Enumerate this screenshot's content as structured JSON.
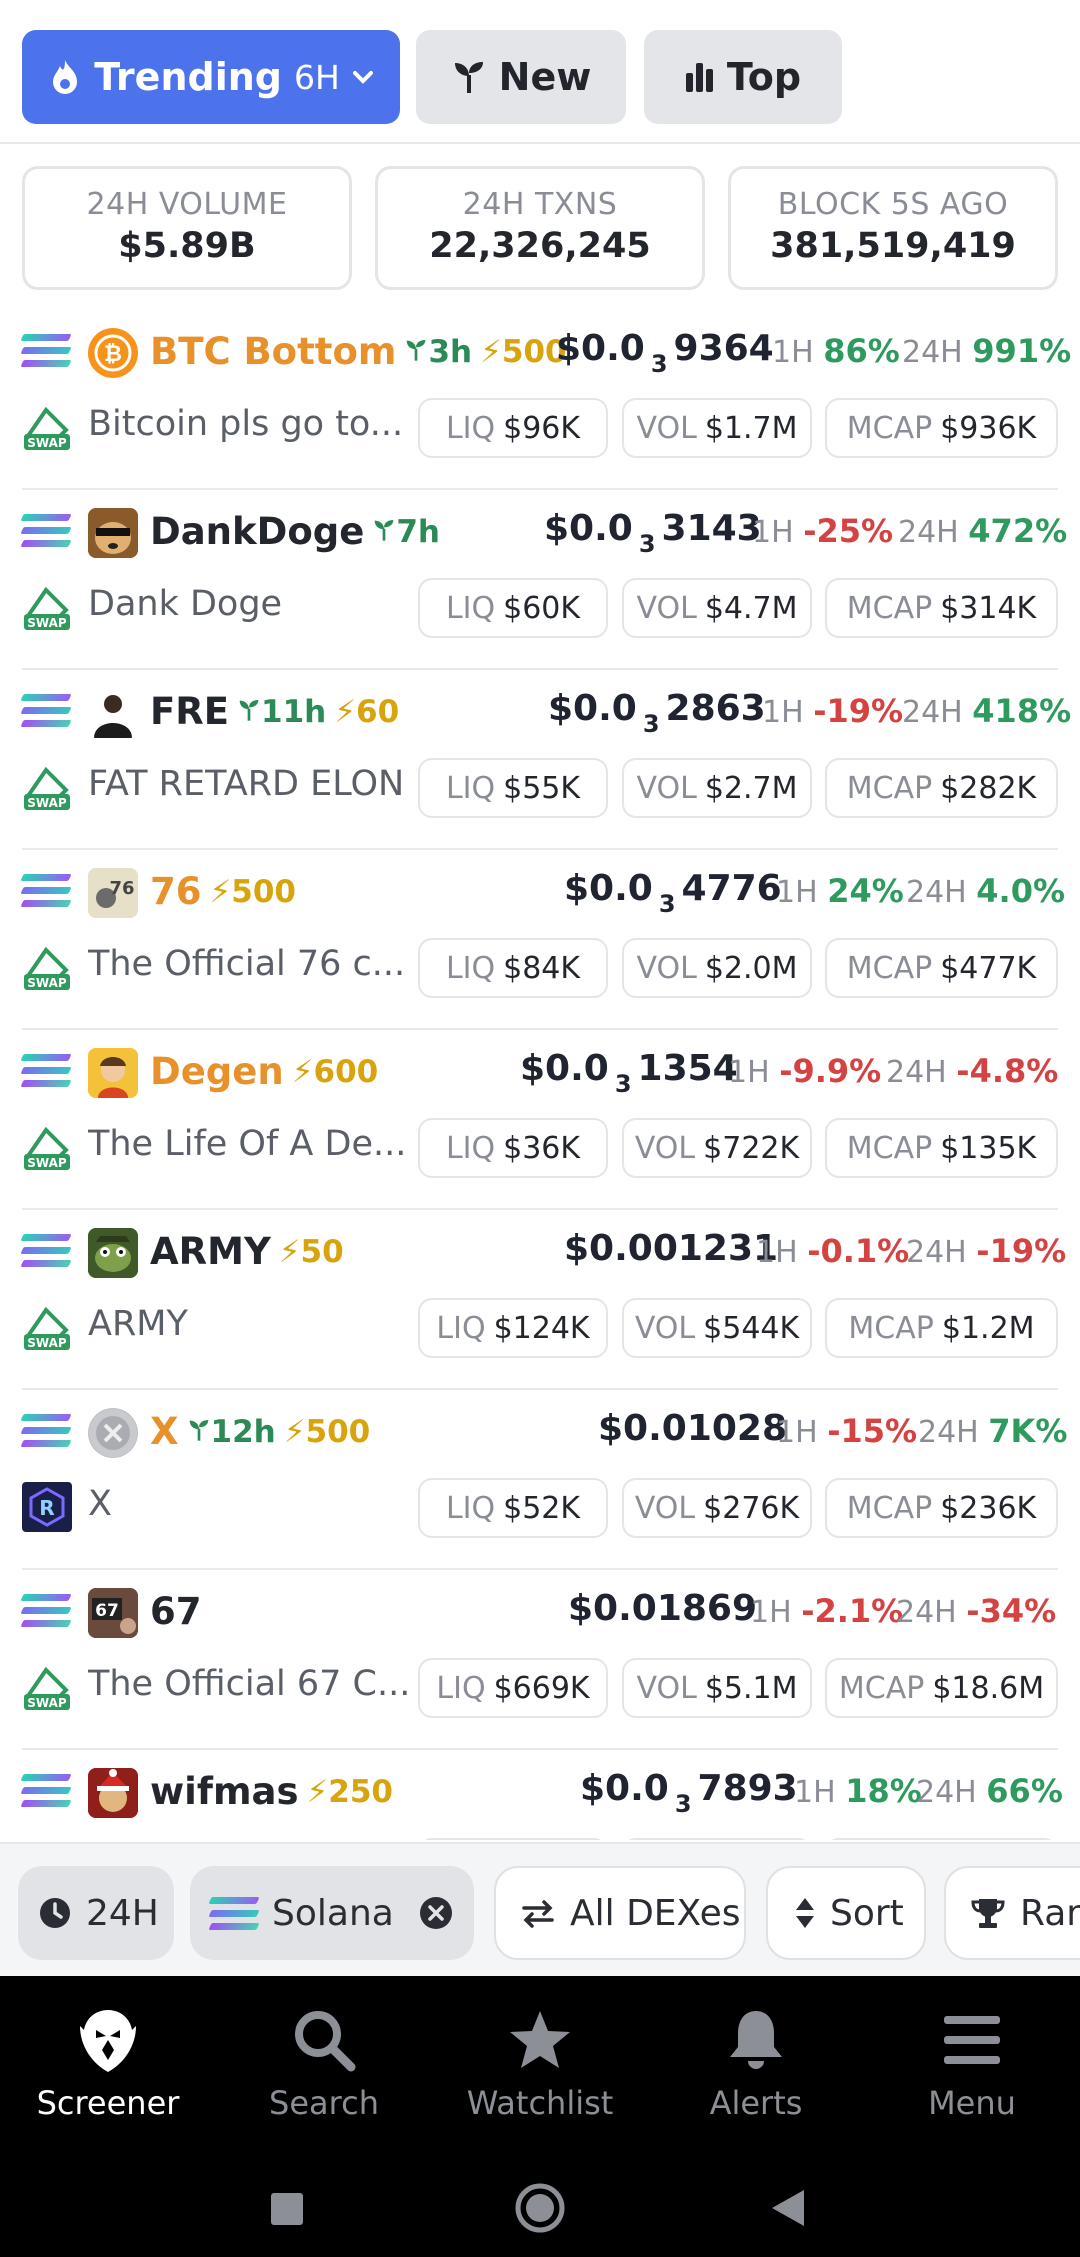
{
  "tabs": {
    "trending": {
      "label": "Trending",
      "period": "6H"
    },
    "new": {
      "label": "New"
    },
    "top": {
      "label": "Top"
    }
  },
  "stats": [
    {
      "label": "24H VOLUME",
      "value": "$5.89B"
    },
    {
      "label": "24H TXNS",
      "value": "22,326,245"
    },
    {
      "label": "BLOCK 5S AGO",
      "value": "381,519,419"
    }
  ],
  "pairs": [
    {
      "symbol": "BTC Bottom",
      "age": "3h",
      "boost": "500",
      "price_prefix": "$0.0",
      "price_zeros": "3",
      "price_rest": "9364",
      "h1": "86%",
      "h24": "991%",
      "name": "Bitcoin pls go to...",
      "liq": "$96K",
      "vol": "$1.7M",
      "mcap": "$936K"
    },
    {
      "symbol": "DankDoge",
      "age": "7h",
      "boost": "",
      "price_prefix": "$0.0",
      "price_zeros": "3",
      "price_rest": "3143",
      "h1": "-25%",
      "h24": "472%",
      "name": "Dank Doge",
      "liq": "$60K",
      "vol": "$4.7M",
      "mcap": "$314K"
    },
    {
      "symbol": "FRE",
      "age": "11h",
      "boost": "60",
      "price_prefix": "$0.0",
      "price_zeros": "3",
      "price_rest": "2863",
      "h1": "-19%",
      "h24": "418%",
      "name": "FAT RETARD ELON",
      "liq": "$55K",
      "vol": "$2.7M",
      "mcap": "$282K"
    },
    {
      "symbol": "76",
      "age": "",
      "boost": "500",
      "price_prefix": "$0.0",
      "price_zeros": "3",
      "price_rest": "4776",
      "h1": "24%",
      "h24": "4.0%",
      "name": "The Official 76 c...",
      "liq": "$84K",
      "vol": "$2.0M",
      "mcap": "$477K"
    },
    {
      "symbol": "Degen",
      "age": "",
      "boost": "600",
      "price_prefix": "$0.0",
      "price_zeros": "3",
      "price_rest": "1354",
      "h1": "-9.9%",
      "h24": "-4.8%",
      "name": "The Life Of A De...",
      "liq": "$36K",
      "vol": "$722K",
      "mcap": "$135K"
    },
    {
      "symbol": "ARMY",
      "age": "",
      "boost": "50",
      "price_prefix": "$0.001231",
      "price_zeros": "",
      "price_rest": "",
      "h1": "-0.1%",
      "h24": "-19%",
      "name": "ARMY",
      "liq": "$124K",
      "vol": "$544K",
      "mcap": "$1.2M"
    },
    {
      "symbol": "X",
      "age": "12h",
      "boost": "500",
      "price_prefix": "$0.01028",
      "price_zeros": "",
      "price_rest": "",
      "h1": "-15%",
      "h24": "7K%",
      "name": "X",
      "liq": "$52K",
      "vol": "$276K",
      "mcap": "$236K"
    },
    {
      "symbol": "67",
      "age": "",
      "boost": "",
      "price_prefix": "$0.01869",
      "price_zeros": "",
      "price_rest": "",
      "h1": "-2.1%",
      "h24": "-34%",
      "name": "The Official 67 C...",
      "liq": "$669K",
      "vol": "$5.1M",
      "mcap": "$18.6M"
    },
    {
      "symbol": "wifmas",
      "age": "",
      "boost": "250",
      "price_prefix": "$0.0",
      "price_zeros": "3",
      "price_rest": "7893",
      "h1": "18%",
      "h24": "66%",
      "name": "",
      "liq": "",
      "vol": "",
      "mcap": ""
    }
  ],
  "labels": {
    "h1": "1H",
    "h24": "24H",
    "liq": "LIQ",
    "vol": "VOL",
    "mcap": "MCAP"
  },
  "filters": {
    "timeframe": "24H",
    "chain": "Solana",
    "dexes": "All DEXes",
    "sort": "Sort",
    "rank": "Ran"
  },
  "nav": [
    {
      "label": "Screener"
    },
    {
      "label": "Search"
    },
    {
      "label": "Watchlist"
    },
    {
      "label": "Alerts"
    },
    {
      "label": "Menu"
    }
  ],
  "colors": {
    "accent": "#4c73ec",
    "positive": "#2f9a5e",
    "negative": "#d44242",
    "boost": "#d8a30c",
    "symbol_highlight": "#e8912a"
  }
}
